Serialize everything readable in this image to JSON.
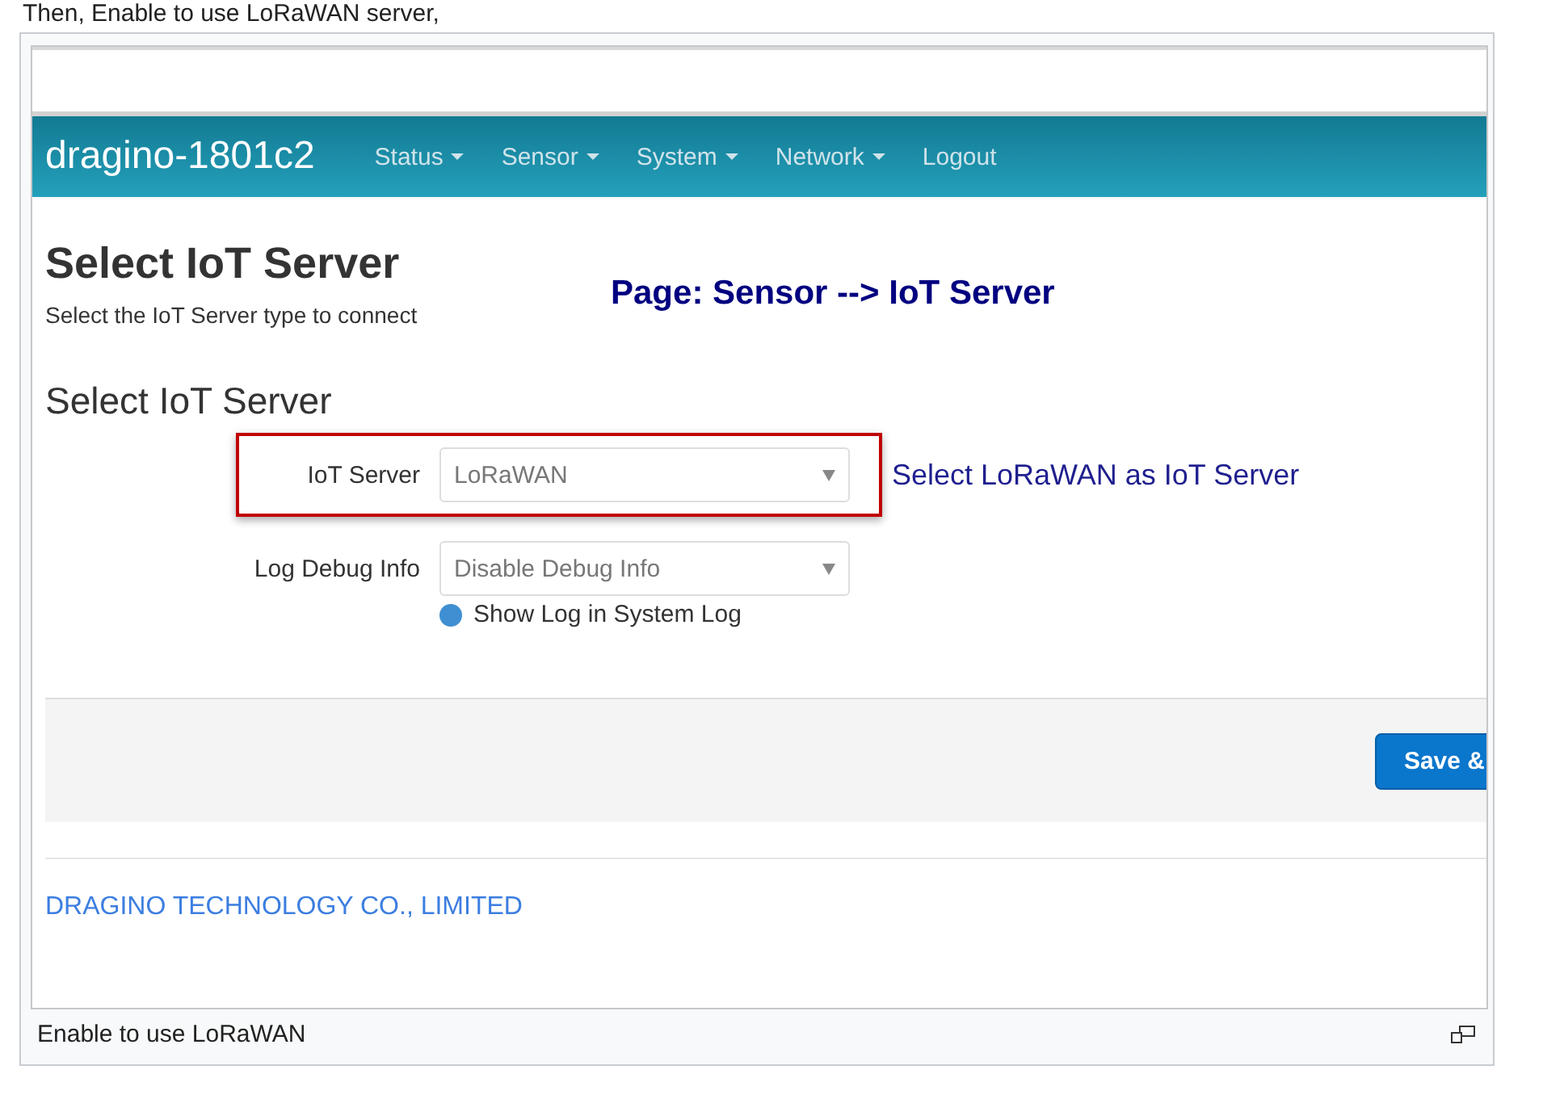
{
  "intro": "Then, Enable to use LoRaWAN server,",
  "figure": {
    "navbar": {
      "brand": "dragino-1801c2",
      "menu": [
        {
          "label": "Status",
          "dropdown": true
        },
        {
          "label": "Sensor",
          "dropdown": true
        },
        {
          "label": "System",
          "dropdown": true
        },
        {
          "label": "Network",
          "dropdown": true
        },
        {
          "label": "Logout",
          "dropdown": false
        }
      ]
    },
    "page": {
      "title": "Select IoT Server",
      "subtitle": "Select the IoT Server type to connect",
      "annotation": "Page: Sensor --> IoT Server",
      "section_title": "Select IoT Server",
      "fields": [
        {
          "label": "IoT Server",
          "value": "LoRaWAN",
          "highlighted": true,
          "note": "Select  LoRaWAN as IoT Server"
        },
        {
          "label": "Log Debug Info",
          "value": "Disable Debug Info",
          "highlighted": false,
          "help": "Show Log in System Log"
        }
      ]
    },
    "save_button": "Save &",
    "footer": "DRAGINO TECHNOLOGY CO., LIMITED"
  },
  "caption": "Enable to use LoRaWAN"
}
